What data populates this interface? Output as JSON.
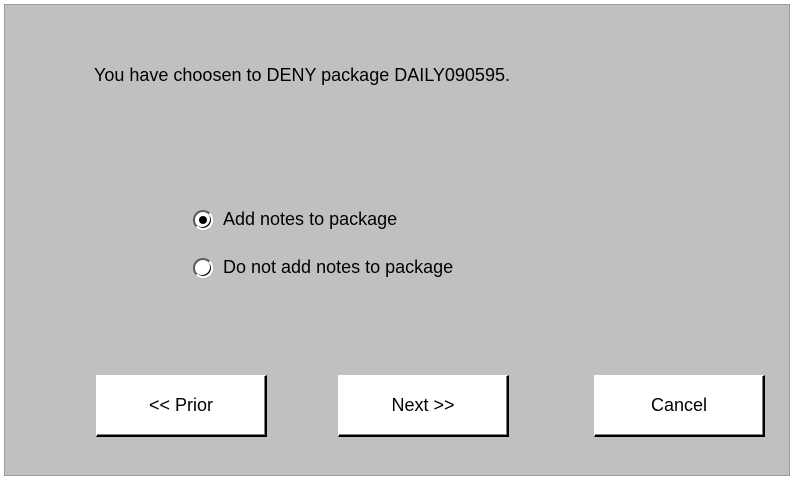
{
  "dialog": {
    "message": "You have choosen to DENY package DAILY090595."
  },
  "options": [
    {
      "label": "Add notes to package",
      "selected": true
    },
    {
      "label": "Do not add notes to package",
      "selected": false
    }
  ],
  "buttons": {
    "prior": "<<  Prior",
    "next": "Next >>",
    "cancel": "Cancel"
  }
}
